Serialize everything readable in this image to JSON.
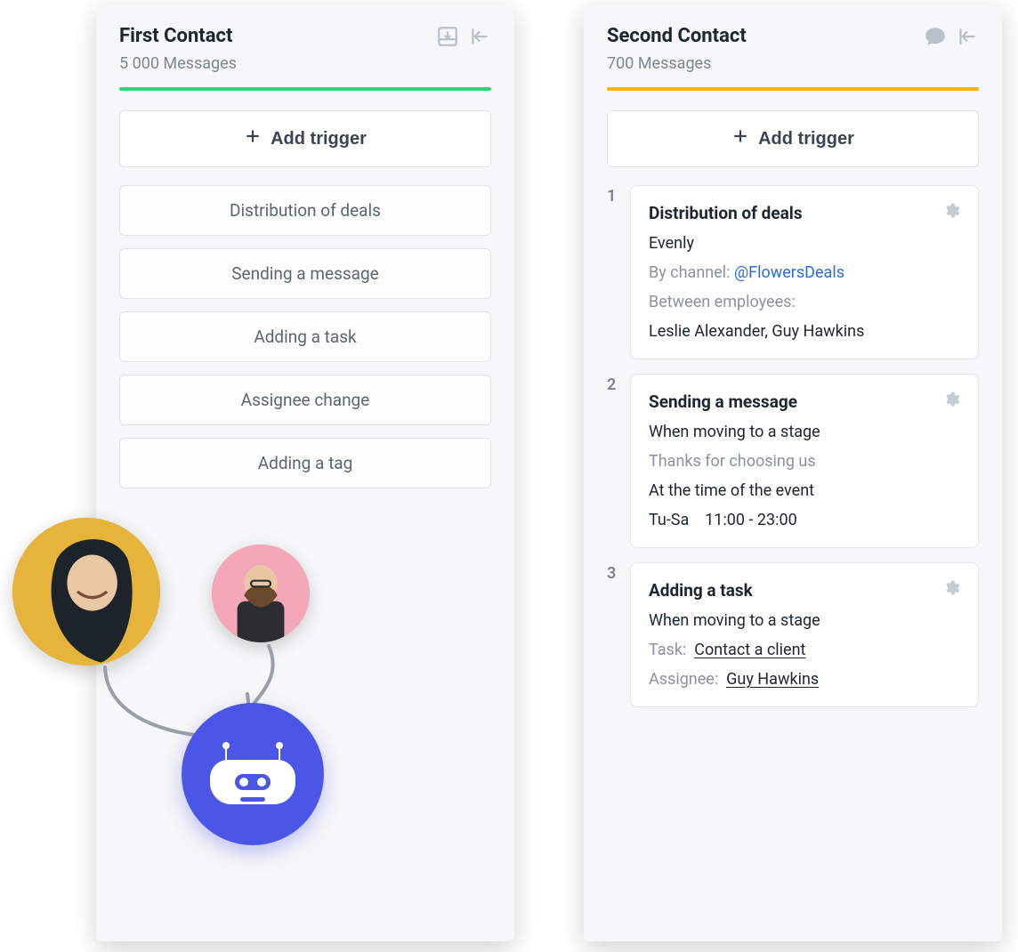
{
  "left": {
    "title": "First Contact",
    "subtitle": "5 000 Messages",
    "add_trigger": "Add trigger",
    "options": [
      "Distribution of deals",
      "Sending a message",
      "Adding a task",
      "Assignee change",
      "Adding a tag"
    ]
  },
  "right": {
    "title": "Second Contact",
    "subtitle": "700 Messages",
    "add_trigger": "Add trigger",
    "steps": [
      {
        "num": "1",
        "title": "Distribution of deals",
        "evenly": "Evenly",
        "by_channel_label": "By channel: ",
        "by_channel_value": "@FlowersDeals",
        "between_label": "Between employees:",
        "between_value": "Leslie Alexander, Guy Hawkins"
      },
      {
        "num": "2",
        "title": "Sending a message",
        "when": "When moving to a stage",
        "template": "Thanks for choosing us",
        "at_time": "At the time of the event",
        "schedule": "Tu-Sa    11:00 - 23:00"
      },
      {
        "num": "3",
        "title": "Adding a task",
        "when": "When moving to a stage",
        "task_label": "Task:",
        "task_value": "Contact a client",
        "assignee_label": "Assignee:",
        "assignee_value": "Guy Hawkins"
      }
    ]
  }
}
